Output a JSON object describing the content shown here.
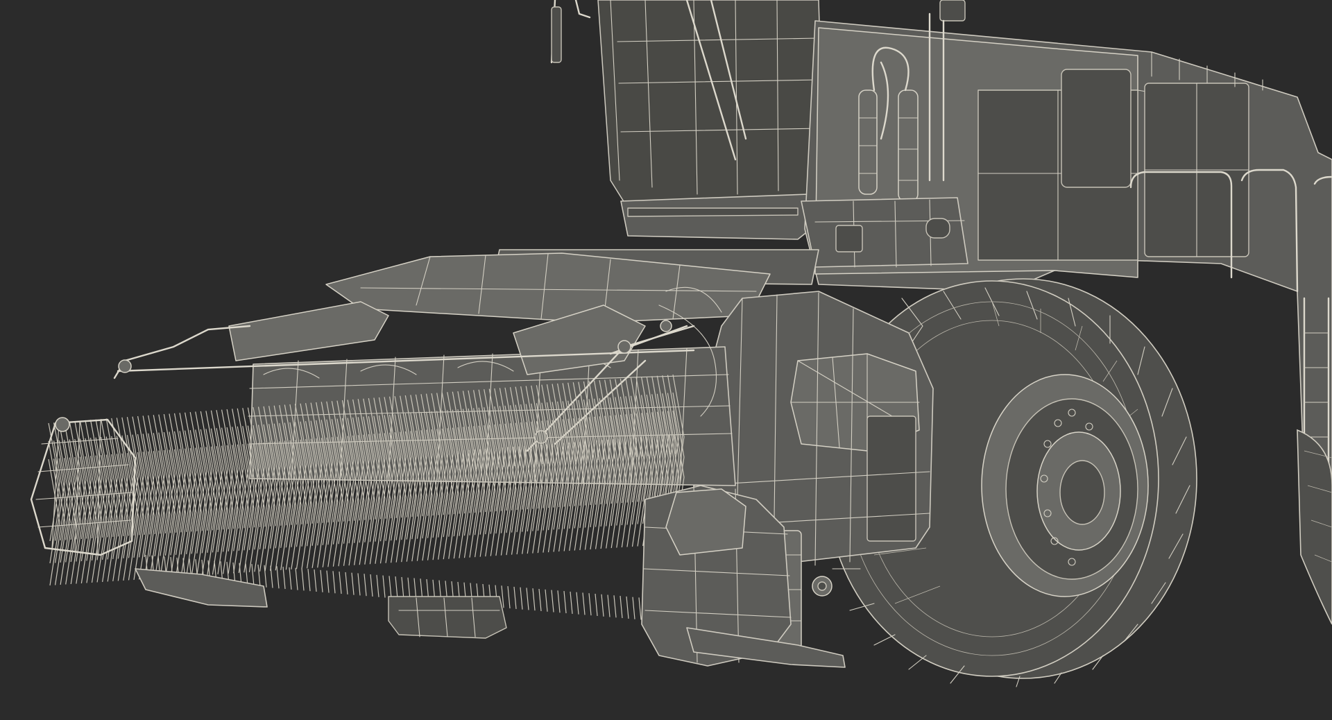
{
  "scene": {
    "background_color": "#2b2b2b",
    "model_fill_color": "#5c5c59",
    "wireframe_color": "#cfcbc0"
  }
}
